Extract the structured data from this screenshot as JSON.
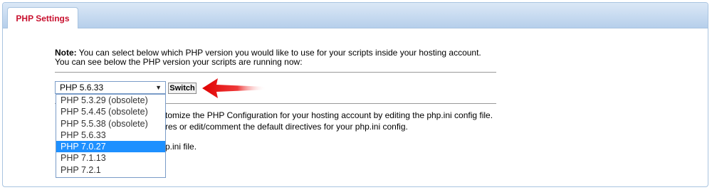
{
  "tab": {
    "label": "PHP Settings"
  },
  "note": {
    "prefix": "Note:",
    "line1": "You can select below which PHP version you would like to use for your scripts inside your hosting account.",
    "line2": "You can see below the PHP version your scripts are running now:"
  },
  "version_select": {
    "current": "PHP 5.6.33",
    "options": [
      {
        "label": "PHP 5.3.29 (obsolete)",
        "selected": false
      },
      {
        "label": "PHP 5.4.45 (obsolete)",
        "selected": false
      },
      {
        "label": "PHP 5.5.38 (obsolete)",
        "selected": false
      },
      {
        "label": "PHP 5.6.33",
        "selected": false
      },
      {
        "label": "PHP 7.0.27",
        "selected": true
      },
      {
        "label": "PHP 7.1.13",
        "selected": false
      },
      {
        "label": "PHP 7.2.1",
        "selected": false
      }
    ]
  },
  "switch_button": {
    "label": "Switch"
  },
  "config_text": {
    "line1": "tomize the PHP Configuration for your hosting account by editing the php.ini config file.",
    "line2": "res or edit/comment the default directives for your php.ini config.",
    "line3": "p.ini file."
  },
  "colors": {
    "tab_text": "#c8102e",
    "selected_option": "#1e90ff",
    "arrow": "#e00000"
  }
}
